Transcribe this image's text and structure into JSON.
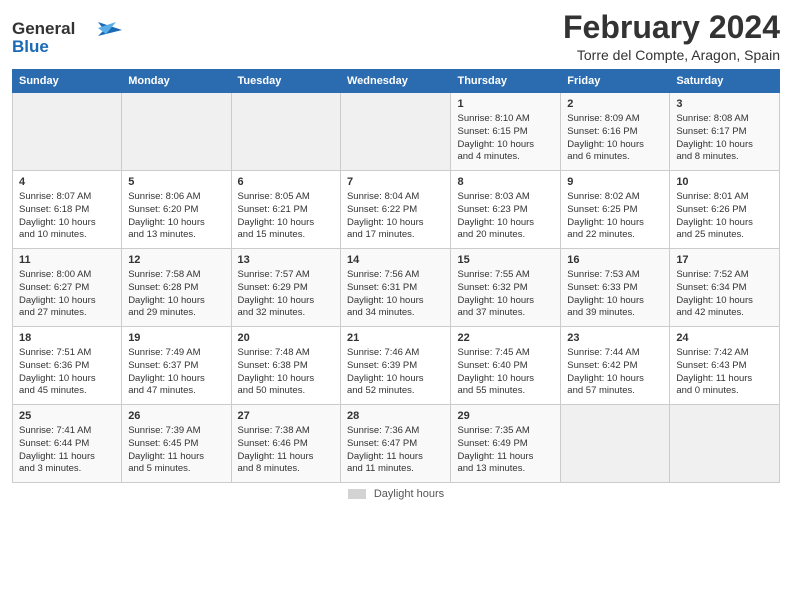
{
  "logo": {
    "line1": "General",
    "line2": "Blue"
  },
  "title": "February 2024",
  "subtitle": "Torre del Compte, Aragon, Spain",
  "days_header": [
    "Sunday",
    "Monday",
    "Tuesday",
    "Wednesday",
    "Thursday",
    "Friday",
    "Saturday"
  ],
  "weeks": [
    [
      {
        "number": "",
        "info": ""
      },
      {
        "number": "",
        "info": ""
      },
      {
        "number": "",
        "info": ""
      },
      {
        "number": "",
        "info": ""
      },
      {
        "number": "1",
        "info": "Sunrise: 8:10 AM\nSunset: 6:15 PM\nDaylight: 10 hours\nand 4 minutes."
      },
      {
        "number": "2",
        "info": "Sunrise: 8:09 AM\nSunset: 6:16 PM\nDaylight: 10 hours\nand 6 minutes."
      },
      {
        "number": "3",
        "info": "Sunrise: 8:08 AM\nSunset: 6:17 PM\nDaylight: 10 hours\nand 8 minutes."
      }
    ],
    [
      {
        "number": "4",
        "info": "Sunrise: 8:07 AM\nSunset: 6:18 PM\nDaylight: 10 hours\nand 10 minutes."
      },
      {
        "number": "5",
        "info": "Sunrise: 8:06 AM\nSunset: 6:20 PM\nDaylight: 10 hours\nand 13 minutes."
      },
      {
        "number": "6",
        "info": "Sunrise: 8:05 AM\nSunset: 6:21 PM\nDaylight: 10 hours\nand 15 minutes."
      },
      {
        "number": "7",
        "info": "Sunrise: 8:04 AM\nSunset: 6:22 PM\nDaylight: 10 hours\nand 17 minutes."
      },
      {
        "number": "8",
        "info": "Sunrise: 8:03 AM\nSunset: 6:23 PM\nDaylight: 10 hours\nand 20 minutes."
      },
      {
        "number": "9",
        "info": "Sunrise: 8:02 AM\nSunset: 6:25 PM\nDaylight: 10 hours\nand 22 minutes."
      },
      {
        "number": "10",
        "info": "Sunrise: 8:01 AM\nSunset: 6:26 PM\nDaylight: 10 hours\nand 25 minutes."
      }
    ],
    [
      {
        "number": "11",
        "info": "Sunrise: 8:00 AM\nSunset: 6:27 PM\nDaylight: 10 hours\nand 27 minutes."
      },
      {
        "number": "12",
        "info": "Sunrise: 7:58 AM\nSunset: 6:28 PM\nDaylight: 10 hours\nand 29 minutes."
      },
      {
        "number": "13",
        "info": "Sunrise: 7:57 AM\nSunset: 6:29 PM\nDaylight: 10 hours\nand 32 minutes."
      },
      {
        "number": "14",
        "info": "Sunrise: 7:56 AM\nSunset: 6:31 PM\nDaylight: 10 hours\nand 34 minutes."
      },
      {
        "number": "15",
        "info": "Sunrise: 7:55 AM\nSunset: 6:32 PM\nDaylight: 10 hours\nand 37 minutes."
      },
      {
        "number": "16",
        "info": "Sunrise: 7:53 AM\nSunset: 6:33 PM\nDaylight: 10 hours\nand 39 minutes."
      },
      {
        "number": "17",
        "info": "Sunrise: 7:52 AM\nSunset: 6:34 PM\nDaylight: 10 hours\nand 42 minutes."
      }
    ],
    [
      {
        "number": "18",
        "info": "Sunrise: 7:51 AM\nSunset: 6:36 PM\nDaylight: 10 hours\nand 45 minutes."
      },
      {
        "number": "19",
        "info": "Sunrise: 7:49 AM\nSunset: 6:37 PM\nDaylight: 10 hours\nand 47 minutes."
      },
      {
        "number": "20",
        "info": "Sunrise: 7:48 AM\nSunset: 6:38 PM\nDaylight: 10 hours\nand 50 minutes."
      },
      {
        "number": "21",
        "info": "Sunrise: 7:46 AM\nSunset: 6:39 PM\nDaylight: 10 hours\nand 52 minutes."
      },
      {
        "number": "22",
        "info": "Sunrise: 7:45 AM\nSunset: 6:40 PM\nDaylight: 10 hours\nand 55 minutes."
      },
      {
        "number": "23",
        "info": "Sunrise: 7:44 AM\nSunset: 6:42 PM\nDaylight: 10 hours\nand 57 minutes."
      },
      {
        "number": "24",
        "info": "Sunrise: 7:42 AM\nSunset: 6:43 PM\nDaylight: 11 hours\nand 0 minutes."
      }
    ],
    [
      {
        "number": "25",
        "info": "Sunrise: 7:41 AM\nSunset: 6:44 PM\nDaylight: 11 hours\nand 3 minutes."
      },
      {
        "number": "26",
        "info": "Sunrise: 7:39 AM\nSunset: 6:45 PM\nDaylight: 11 hours\nand 5 minutes."
      },
      {
        "number": "27",
        "info": "Sunrise: 7:38 AM\nSunset: 6:46 PM\nDaylight: 11 hours\nand 8 minutes."
      },
      {
        "number": "28",
        "info": "Sunrise: 7:36 AM\nSunset: 6:47 PM\nDaylight: 11 hours\nand 11 minutes."
      },
      {
        "number": "29",
        "info": "Sunrise: 7:35 AM\nSunset: 6:49 PM\nDaylight: 11 hours\nand 13 minutes."
      },
      {
        "number": "",
        "info": ""
      },
      {
        "number": "",
        "info": ""
      }
    ]
  ],
  "footer": {
    "swatch_label": "Daylight hours"
  }
}
